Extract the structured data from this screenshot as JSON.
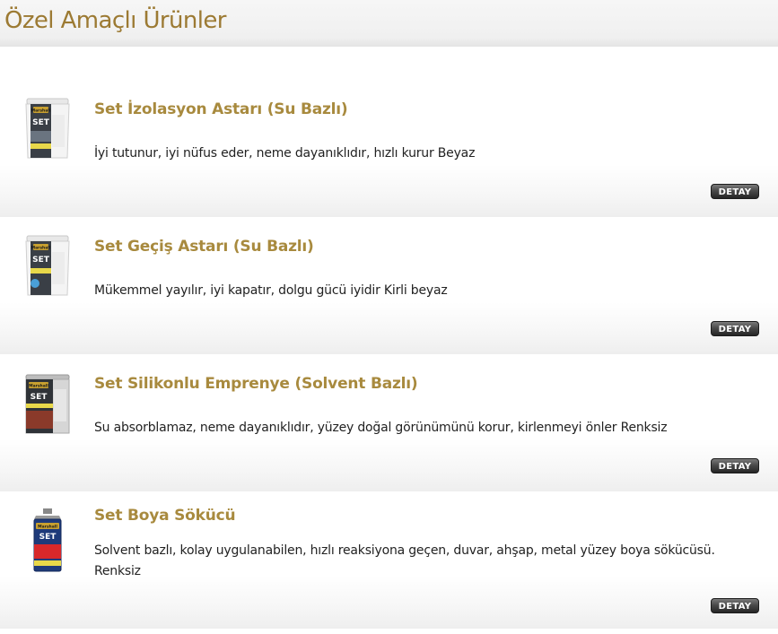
{
  "page": {
    "title": "Özel Amaçlı Ürünler"
  },
  "products": [
    {
      "name": "Set İzolasyon Astarı (Su Bazlı)",
      "description": "İyi tutunur, iyi nüfus eder, neme dayanıklıdır, hızlı kurur Beyaz",
      "image_icon": "paint-bucket-icon",
      "image_label": "Marshall",
      "image_brand": "SET",
      "detail_label": "DETAY"
    },
    {
      "name": "Set Geçiş Astarı (Su Bazlı)",
      "description": "Mükemmel yayılır, iyi kapatır, dolgu gücü iyidir Kirli beyaz",
      "image_icon": "paint-bucket-icon",
      "image_label": "Marshall",
      "image_brand": "SET",
      "detail_label": "DETAY"
    },
    {
      "name": "Set Silikonlu Emprenye (Solvent Bazlı)",
      "description": "Su absorblamaz, neme dayanıklıdır, yüzey doğal görünümünü korur, kirlenmeyi önler Renksiz",
      "image_icon": "paint-can-icon",
      "image_label": "Marshall",
      "image_brand": "SET",
      "detail_label": "DETAY"
    },
    {
      "name": "Set Boya Sökücü",
      "description": "Solvent bazlı, kolay uygulanabilen, hızlı reaksiyona geçen, duvar, ahşap, metal yüzey boya sökücüsü. Renksiz",
      "image_icon": "remover-can-icon",
      "image_label": "Marshall",
      "image_brand": "SET",
      "detail_label": "DETAY"
    }
  ],
  "colors": {
    "title": "#9c7a33",
    "product_name": "#a88a3e",
    "text": "#222222",
    "button": "#333333"
  }
}
